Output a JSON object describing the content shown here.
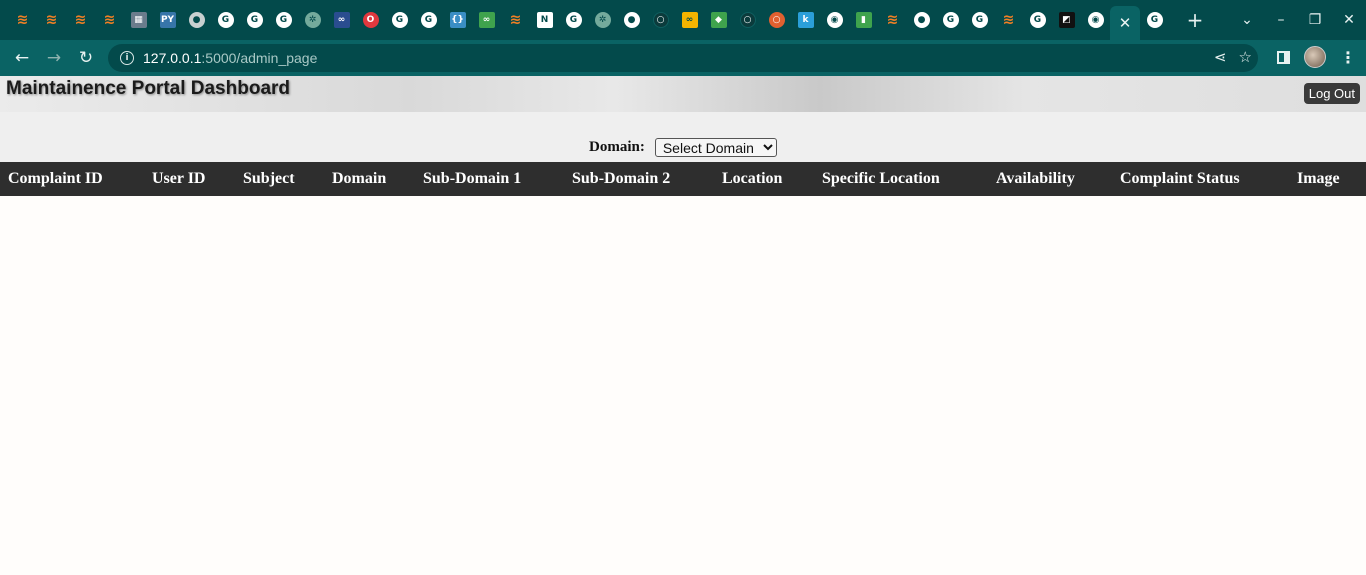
{
  "browser": {
    "tab_favicons": [
      {
        "icon": "stack-icon",
        "color": "#f48024",
        "glyph": "≋",
        "shape": "round"
      },
      {
        "icon": "stack-icon",
        "color": "#f48024",
        "glyph": "≋",
        "shape": "round"
      },
      {
        "icon": "stack-icon",
        "color": "#f48024",
        "glyph": "≋",
        "shape": "round"
      },
      {
        "icon": "stack-icon",
        "color": "#f48024",
        "glyph": "≋",
        "shape": "round"
      },
      {
        "icon": "image-icon",
        "color": "#6b7c8c",
        "glyph": "▦",
        "shape": "square"
      },
      {
        "icon": "pypi-icon",
        "color": "#3775a9",
        "glyph": "PY",
        "shape": "square"
      },
      {
        "icon": "globe-icon",
        "color": "#c8d0d0",
        "glyph": "●",
        "shape": "round"
      },
      {
        "icon": "google-icon",
        "color": "#ffffff",
        "glyph": "G",
        "shape": "round"
      },
      {
        "icon": "google-icon",
        "color": "#ffffff",
        "glyph": "G",
        "shape": "round"
      },
      {
        "icon": "google-icon",
        "color": "#ffffff",
        "glyph": "G",
        "shape": "round"
      },
      {
        "icon": "chatgpt-icon",
        "color": "#74aa9c",
        "glyph": "✲",
        "shape": "round"
      },
      {
        "icon": "infinity-icon",
        "color": "#2a4d8f",
        "glyph": "∞",
        "shape": "square"
      },
      {
        "icon": "opera-icon",
        "color": "#e0383e",
        "glyph": "O",
        "shape": "round"
      },
      {
        "icon": "google-icon",
        "color": "#ffffff",
        "glyph": "G",
        "shape": "round"
      },
      {
        "icon": "google-icon",
        "color": "#ffffff",
        "glyph": "G",
        "shape": "round"
      },
      {
        "icon": "braces-icon",
        "color": "#3a8ec4",
        "glyph": "{}",
        "shape": "square"
      },
      {
        "icon": "link-icon",
        "color": "#3fa34d",
        "glyph": "∞",
        "shape": "square"
      },
      {
        "icon": "stack-icon",
        "color": "#f48024",
        "glyph": "≋",
        "shape": "round"
      },
      {
        "icon": "notion-icon",
        "color": "#ffffff",
        "glyph": "N",
        "shape": "square"
      },
      {
        "icon": "google-icon",
        "color": "#ffffff",
        "glyph": "G",
        "shape": "round"
      },
      {
        "icon": "chatgpt-icon",
        "color": "#74aa9c",
        "glyph": "✲",
        "shape": "round"
      },
      {
        "icon": "globe-icon",
        "color": "#ffffff",
        "glyph": "●",
        "shape": "round"
      },
      {
        "icon": "github-icon",
        "color": "#0b3b3c",
        "glyph": "○",
        "shape": "round"
      },
      {
        "icon": "coursera-icon",
        "color": "#f5b400",
        "glyph": "∞",
        "shape": "square"
      },
      {
        "icon": "leaf-icon",
        "color": "#3fa34d",
        "glyph": "◆",
        "shape": "square"
      },
      {
        "icon": "github-icon",
        "color": "#0b3b3c",
        "glyph": "○",
        "shape": "round"
      },
      {
        "icon": "power-icon",
        "color": "#e06030",
        "glyph": "○",
        "shape": "round"
      },
      {
        "icon": "k-icon",
        "color": "#2b9fd9",
        "glyph": "k",
        "shape": "square"
      },
      {
        "icon": "chrome-icon",
        "color": "#ffffff",
        "glyph": "◉",
        "shape": "round"
      },
      {
        "icon": "mongodb-icon",
        "color": "#3fa34d",
        "glyph": "▮",
        "shape": "square"
      },
      {
        "icon": "stack-icon",
        "color": "#f48024",
        "glyph": "≋",
        "shape": "round"
      },
      {
        "icon": "globe-icon",
        "color": "#ffffff",
        "glyph": "●",
        "shape": "round"
      },
      {
        "icon": "google-icon",
        "color": "#ffffff",
        "glyph": "G",
        "shape": "round"
      },
      {
        "icon": "google-icon",
        "color": "#ffffff",
        "glyph": "G",
        "shape": "round"
      },
      {
        "icon": "stack-icon",
        "color": "#f48024",
        "glyph": "≋",
        "shape": "round"
      },
      {
        "icon": "google-icon",
        "color": "#ffffff",
        "glyph": "G",
        "shape": "round"
      },
      {
        "icon": "terminal-icon",
        "color": "#111111",
        "glyph": "◩",
        "shape": "square"
      },
      {
        "icon": "chrome-icon",
        "color": "#ffffff",
        "glyph": "◉",
        "shape": "round"
      }
    ],
    "active_tab": {
      "icon": "close-icon",
      "glyph": "✕"
    },
    "after_active": {
      "icon": "google-icon",
      "color": "#ffffff",
      "glyph": "G"
    },
    "new_tab_glyph": "+",
    "url": {
      "host": "127.0.0.1",
      "path": ":5000/admin_page"
    },
    "colors": {
      "frame": "#034a4b",
      "toolbar": "#0a6364"
    }
  },
  "header": {
    "title": "Maintainence Portal Dashboard",
    "logout_label": "Log Out"
  },
  "filter": {
    "domain_label": "Domain:",
    "domain_selected": "Select Domain"
  },
  "table": {
    "columns": [
      "Complaint ID",
      "User ID",
      "Subject",
      "Domain",
      "Sub-Domain 1",
      "Sub-Domain 2",
      "Location",
      "Specific Location",
      "Availability",
      "Complaint Status",
      "Image"
    ],
    "rows": []
  }
}
